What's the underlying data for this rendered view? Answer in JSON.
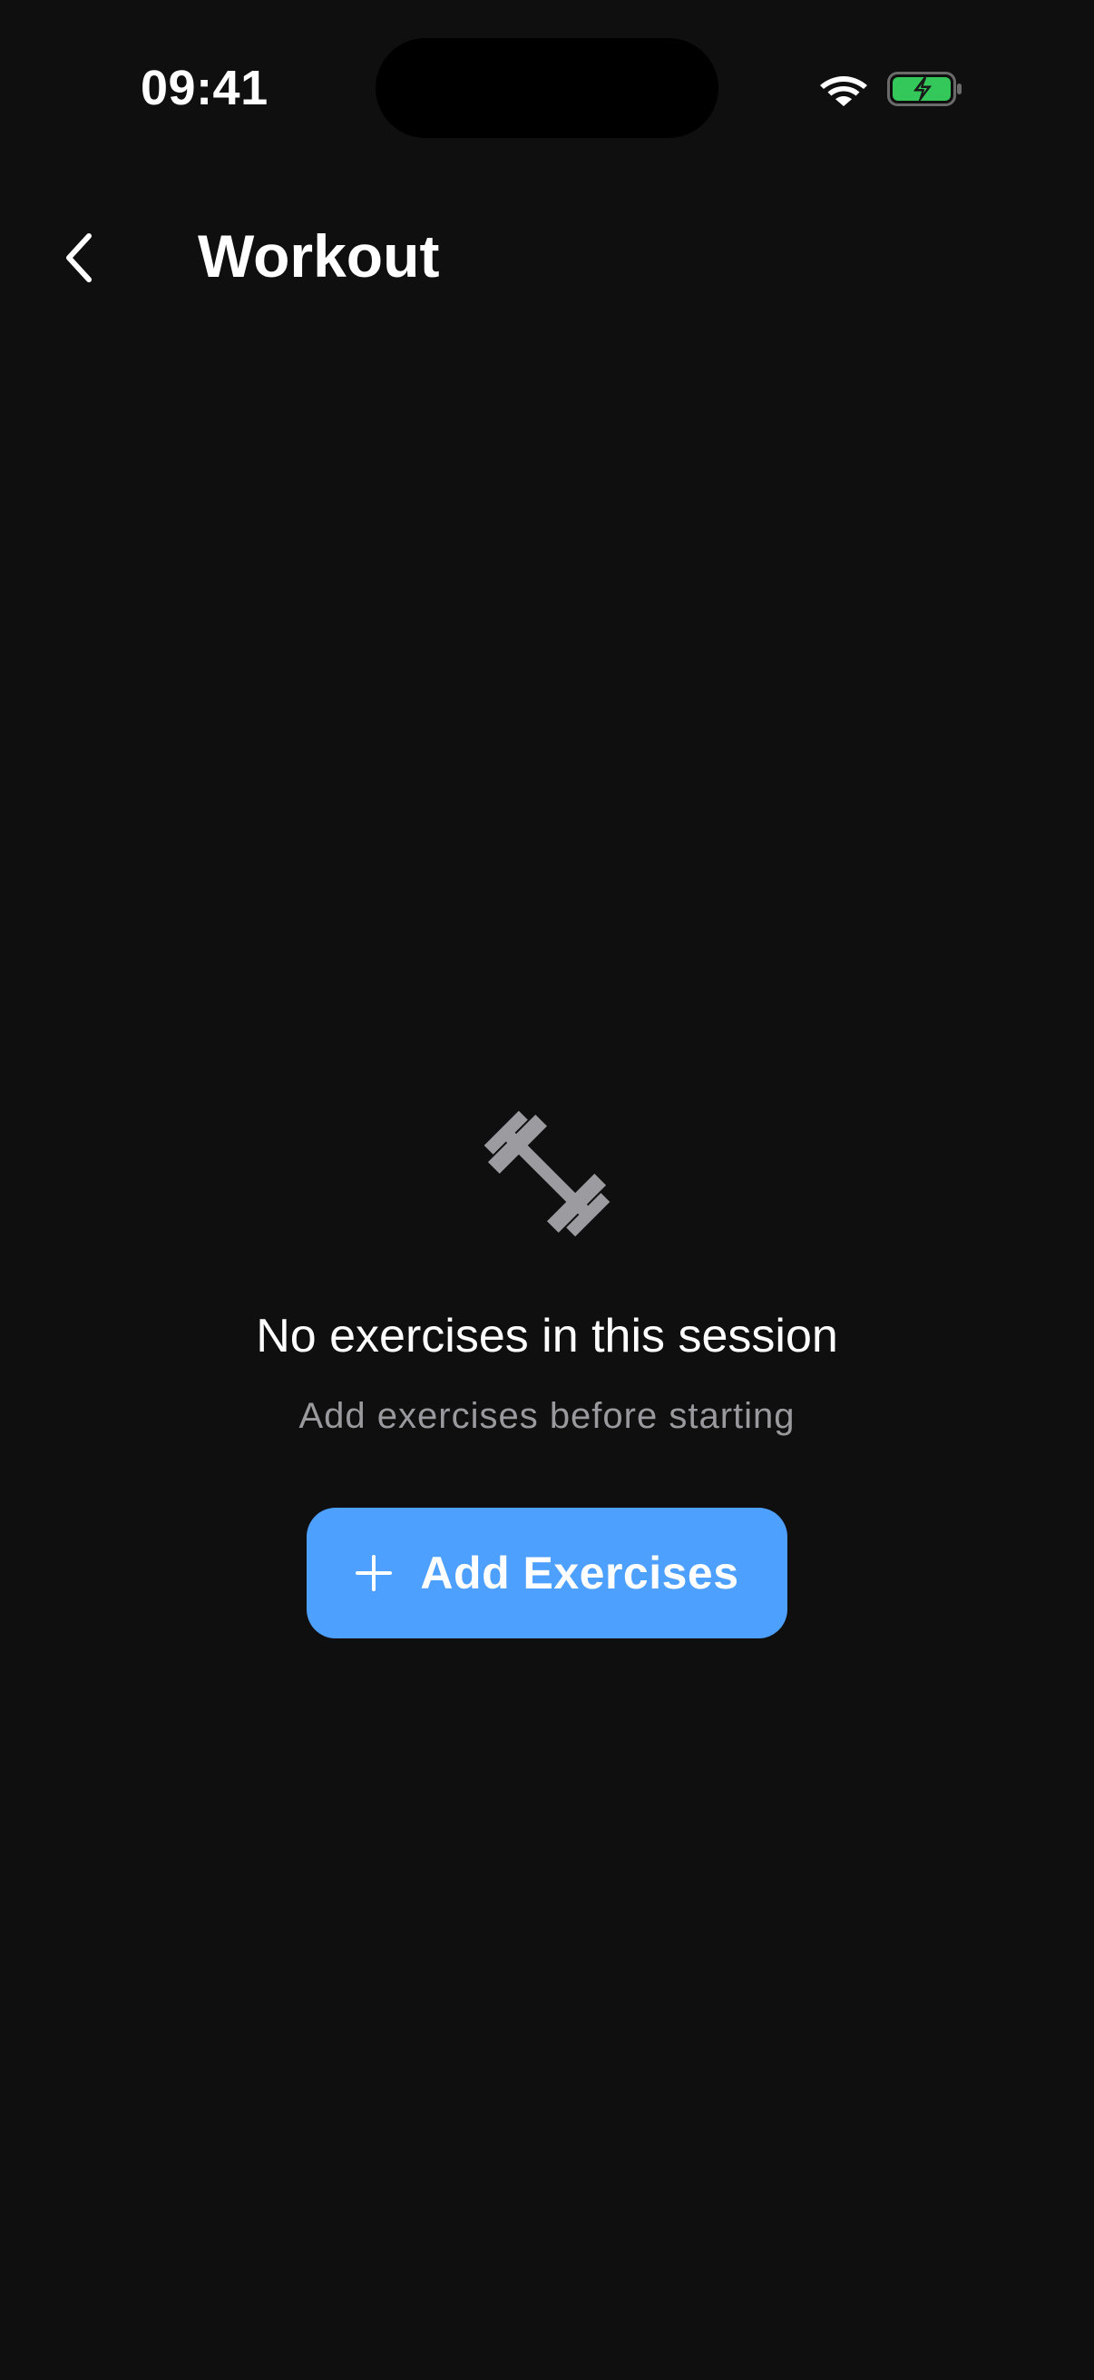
{
  "status_bar": {
    "time": "09:41"
  },
  "header": {
    "title": "Workout"
  },
  "empty_state": {
    "icon": "dumbbell-icon",
    "title": "No exercises in this session",
    "subtitle": "Add exercises before starting"
  },
  "actions": {
    "add_exercises_label": "Add Exercises"
  },
  "colors": {
    "background": "#0f0f10",
    "accent": "#4ea0ff",
    "secondary_text": "#9a9a9e",
    "icon_gray": "#9c9ca0",
    "battery_green": "#34c759"
  }
}
